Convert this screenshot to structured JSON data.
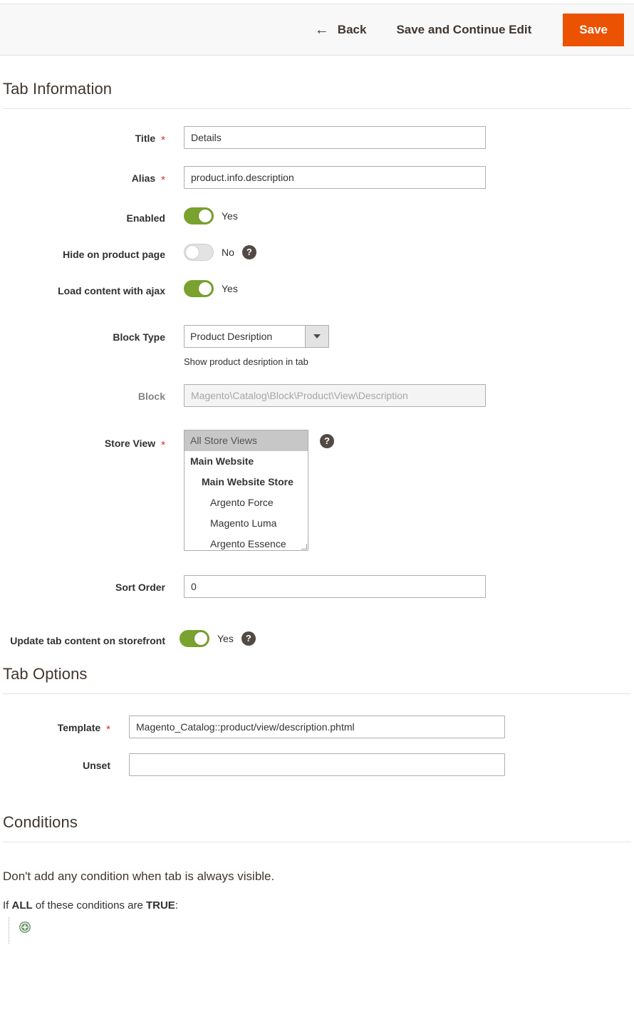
{
  "toolbar": {
    "back_label": "Back",
    "back_icon": "arrow-left-icon",
    "save_continue_label": "Save and Continue Edit",
    "save_label": "Save",
    "save_color": "#eb5202"
  },
  "sections": {
    "tab_information": {
      "legend": "Tab Information",
      "fields": {
        "title": {
          "label": "Title",
          "required": "*",
          "value": "Details"
        },
        "alias": {
          "label": "Alias",
          "required": "*",
          "value": "product.info.description"
        },
        "enabled": {
          "label": "Enabled",
          "state": "Yes",
          "on": true
        },
        "hide_on_product_page": {
          "label": "Hide on product page",
          "state": "No",
          "on": false,
          "help_icon": "question-mark-icon"
        },
        "load_content_with_ajax": {
          "label": "Load content with ajax",
          "state": "Yes",
          "on": true
        },
        "block_type": {
          "label": "Block Type",
          "value": "Product Desription",
          "note": "Show product desription in tab",
          "options": [
            "Product Desription"
          ]
        },
        "block": {
          "label": "Block",
          "placeholder": "Magento\\Catalog\\Block\\Product\\View\\Description",
          "value": "",
          "disabled": true
        },
        "store_view": {
          "label": "Store View",
          "required": "*",
          "help_icon": "question-mark-icon",
          "options": [
            {
              "label": "All Store Views",
              "level": 0,
              "selected": true
            },
            {
              "label": "Main Website",
              "level": 1,
              "selected": false
            },
            {
              "label": "Main Website Store",
              "level": 2,
              "selected": false
            },
            {
              "label": "Argento Force",
              "level": 3,
              "selected": false
            },
            {
              "label": "Magento Luma",
              "level": 3,
              "selected": false
            },
            {
              "label": "Argento Essence",
              "level": 3,
              "selected": false
            }
          ]
        },
        "sort_order": {
          "label": "Sort Order",
          "value": "0"
        },
        "update_tab_content": {
          "label": "Update tab content on storefront",
          "state": "Yes",
          "on": true,
          "help_icon": "question-mark-icon"
        }
      }
    },
    "tab_options": {
      "legend": "Tab Options",
      "fields": {
        "template": {
          "label": "Template",
          "required": "*",
          "value": "Magento_Catalog::product/view/description.phtml"
        },
        "unset": {
          "label": "Unset",
          "value": ""
        }
      }
    },
    "conditions": {
      "legend": "Conditions",
      "description": "Don't add any condition when tab is always visible.",
      "rule": {
        "prefix": "If",
        "aggregator": "ALL",
        "middle": "of these conditions are",
        "value": "TRUE",
        "suffix": ":"
      },
      "add_icon": "add-circle-icon"
    }
  }
}
